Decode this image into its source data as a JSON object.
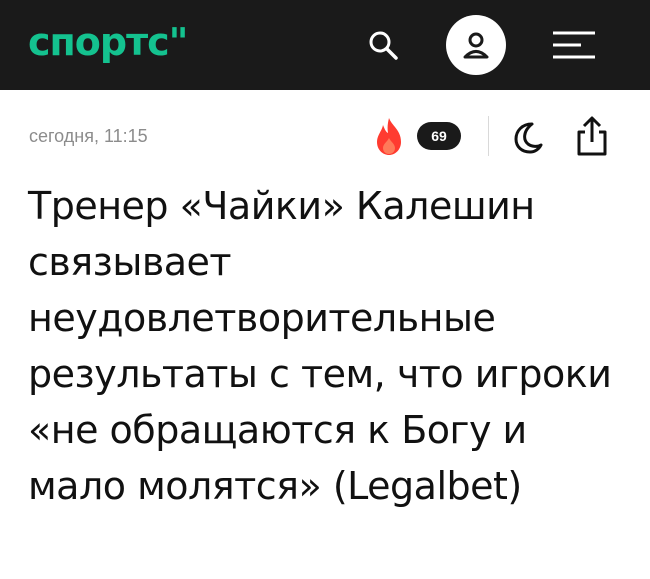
{
  "header": {
    "logo_text": "спортс\"",
    "brand_color": "#14c28f",
    "icons": [
      "search-icon",
      "user-icon",
      "menu-icon"
    ]
  },
  "article": {
    "date": "сегодня, 11:15",
    "comments_count": "69",
    "icons": [
      "fire-icon",
      "moon-icon",
      "share-icon"
    ],
    "title": "Тренер «Чайки» Калешин связывает неудовлетворительные результаты с тем, что игроки «не обращаются к Богу и мало молятся» (Legalbet)"
  }
}
